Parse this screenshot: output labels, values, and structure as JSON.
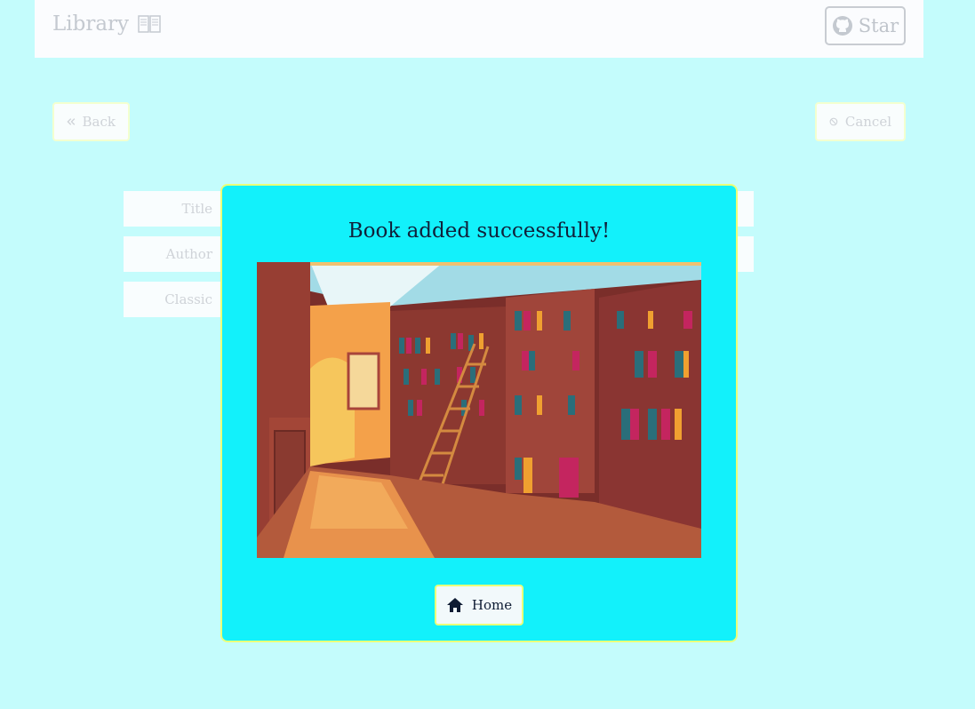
{
  "header": {
    "brand": "Library",
    "brand_icon": "open-book-icon",
    "star_label": "Star",
    "star_icon": "github-icon"
  },
  "nav": {
    "back_label": "Back",
    "back_icon": "double-chevron-left-icon",
    "cancel_label": "Cancel",
    "cancel_icon": "ban-icon"
  },
  "form": {
    "title_label": "Title",
    "author_label": "Author",
    "classic_label": "Classic"
  },
  "modal": {
    "title": "Book added successfully!",
    "image": "library-interior-illustration",
    "home_label": "Home",
    "home_icon": "home-icon"
  }
}
